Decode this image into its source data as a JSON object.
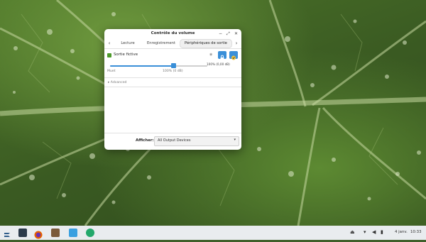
{
  "window": {
    "title": "Contrôle du volume",
    "controls": [
      "−",
      "⤢",
      "✕"
    ]
  },
  "tabs": {
    "prev_arrow": "‹",
    "next_arrow": "›",
    "items": [
      {
        "label": "Lecture",
        "active": false
      },
      {
        "label": "Enregistrement",
        "active": false
      },
      {
        "label": "Périphériques de sortie",
        "active": true
      }
    ]
  },
  "device": {
    "name": "Sortie fictive",
    "checked": true,
    "volume_percent_label": "100% (0,00 dB)",
    "volume_level_percent": 100,
    "slider_min_label": "Muet",
    "slider_mark_label": "100% (0 dB)",
    "advanced_label": "▸ Advanced"
  },
  "footer": {
    "show_label": "Afficher:",
    "dropdown_value": "All Output Devices"
  },
  "taskbar": {
    "right": {
      "date": "4 janv.",
      "time": "10:33"
    }
  },
  "icons": {
    "lock": "lock-icon",
    "vu": "check-icon",
    "device_state": "eye-icon"
  },
  "colors": {
    "accent": "#3a8fd8",
    "device_green": "#4c9a2a",
    "taskbar": "#e9ecef"
  }
}
